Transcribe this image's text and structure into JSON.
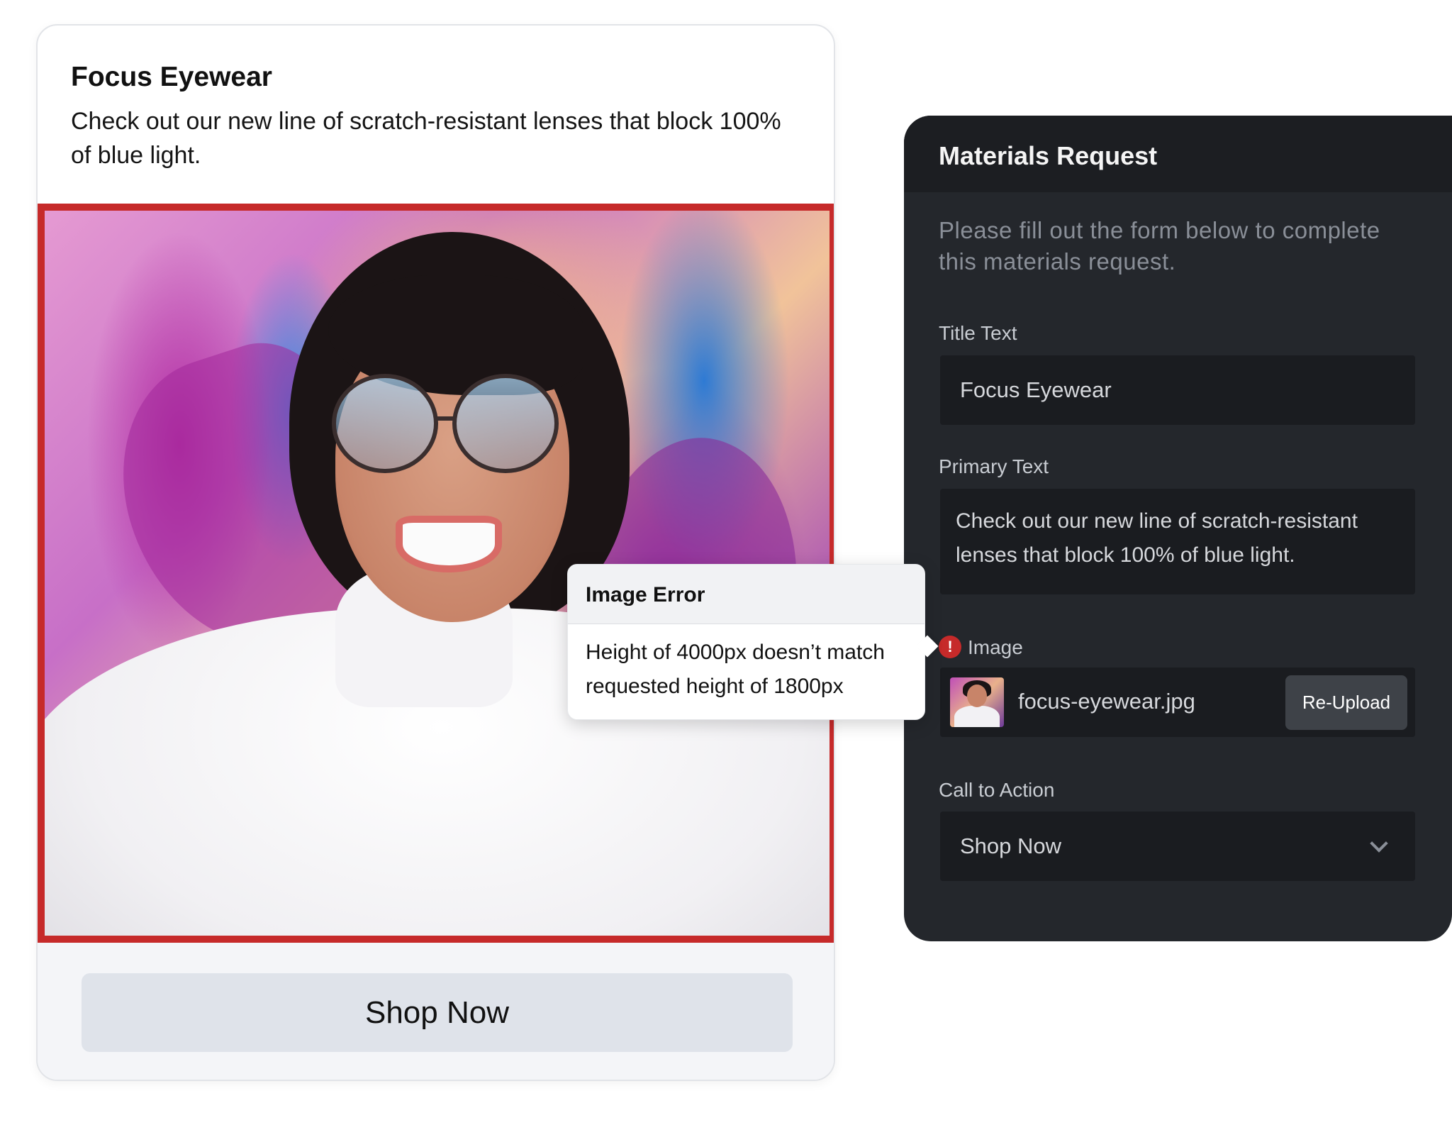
{
  "ad_preview": {
    "title": "Focus Eyewear",
    "body": "Check out our new line of scratch-resistant lenses that block 100% of blue light.",
    "cta_label": "Shop Now",
    "image_error_border_color": "#c62a2a"
  },
  "materials_request": {
    "header": "Materials Request",
    "description": "Please fill out the form below to complete this materials request.",
    "title_text": {
      "label": "Title Text",
      "value": "Focus Eyewear"
    },
    "primary_text": {
      "label": "Primary Text",
      "value": "Check out our new line of scratch-resistant lenses that block 100% of blue light."
    },
    "image": {
      "label": "Image",
      "error_icon": "!",
      "filename": "focus-eyewear.jpg",
      "reupload_label": "Re-Upload"
    },
    "call_to_action": {
      "label": "Call to Action",
      "value": "Shop Now"
    }
  },
  "tooltip": {
    "title": "Image Error",
    "message": "Height of 4000px doesn’t match requested height of 1800px"
  },
  "colors": {
    "error": "#c62a2a",
    "panel_bg": "#24272c",
    "panel_header_bg": "#1c1e22",
    "cta_bg": "#dfe3ea"
  },
  "icons": [
    "exclamation-icon",
    "chevron-down-icon"
  ]
}
